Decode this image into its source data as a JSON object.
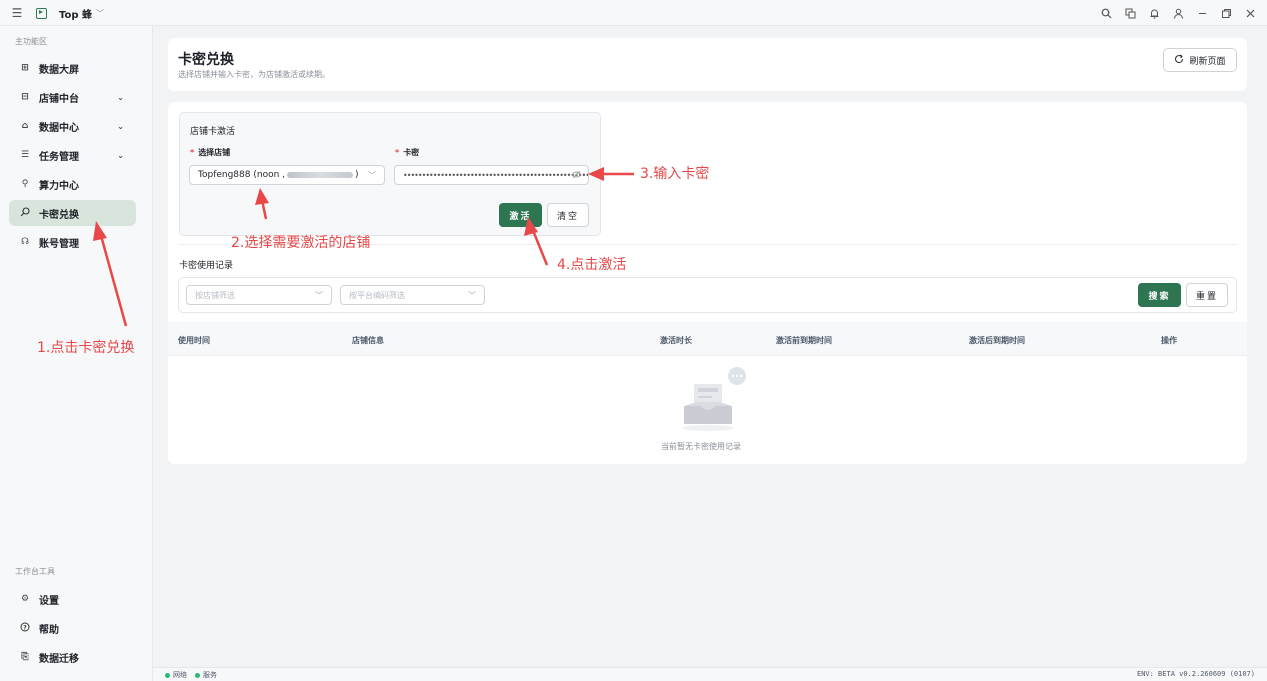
{
  "app": {
    "name": "Top 蜂"
  },
  "sidebar": {
    "section_main": "主功能区",
    "items": [
      {
        "label": "数据大屏",
        "icon": "dashboard-icon"
      },
      {
        "label": "店铺中台",
        "icon": "store-icon"
      },
      {
        "label": "数据中心",
        "icon": "box-icon"
      },
      {
        "label": "任务管理",
        "icon": "list-icon"
      },
      {
        "label": "算力中心",
        "icon": "link-icon"
      },
      {
        "label": "卡密兑换",
        "icon": "key-search-icon"
      },
      {
        "label": "账号管理",
        "icon": "users-icon"
      }
    ],
    "section_tools": "工作台工具",
    "tools": [
      {
        "label": "设置",
        "icon": "gear-icon"
      },
      {
        "label": "帮助",
        "icon": "help-icon"
      },
      {
        "label": "数据迁移",
        "icon": "migrate-icon"
      }
    ]
  },
  "page": {
    "title": "卡密兑换",
    "subtitle": "选择店铺并输入卡密，为店铺激活或续期。",
    "refresh_label": "刷新页面"
  },
  "activation": {
    "title": "店铺卡激活",
    "store_label": "选择店铺",
    "store_value": "Topfeng888 (noon ,",
    "store_value_end": ")",
    "key_label": "卡密",
    "key_value": "••••••••••••••••••••••••••••••••••••••••••••••••••",
    "activate_label": "激活",
    "clear_label": "清空"
  },
  "records": {
    "title": "卡密使用记录",
    "filter_store_placeholder": "按店铺筛选",
    "filter_platform_placeholder": "按平台编码筛选",
    "search_label": "搜索",
    "reset_label": "重置",
    "columns": [
      "使用时间",
      "店铺信息",
      "激活时长",
      "激活前到期时间",
      "激活后到期时间",
      "操作"
    ],
    "empty_text": "当前暂无卡密使用记录"
  },
  "status": {
    "network": "网络",
    "service": "服务",
    "env": "ENV: BETA  v0.2.260609 (0107)"
  },
  "annotations": {
    "step1": "1.点击卡密兑换",
    "step2": "2.选择需要激活的店铺",
    "step3": "3.输入卡密",
    "step4": "4.点击激活"
  },
  "colors": {
    "accent": "#2e7552",
    "annotation": "#e84848",
    "active_bg": "#d8e5dd"
  }
}
